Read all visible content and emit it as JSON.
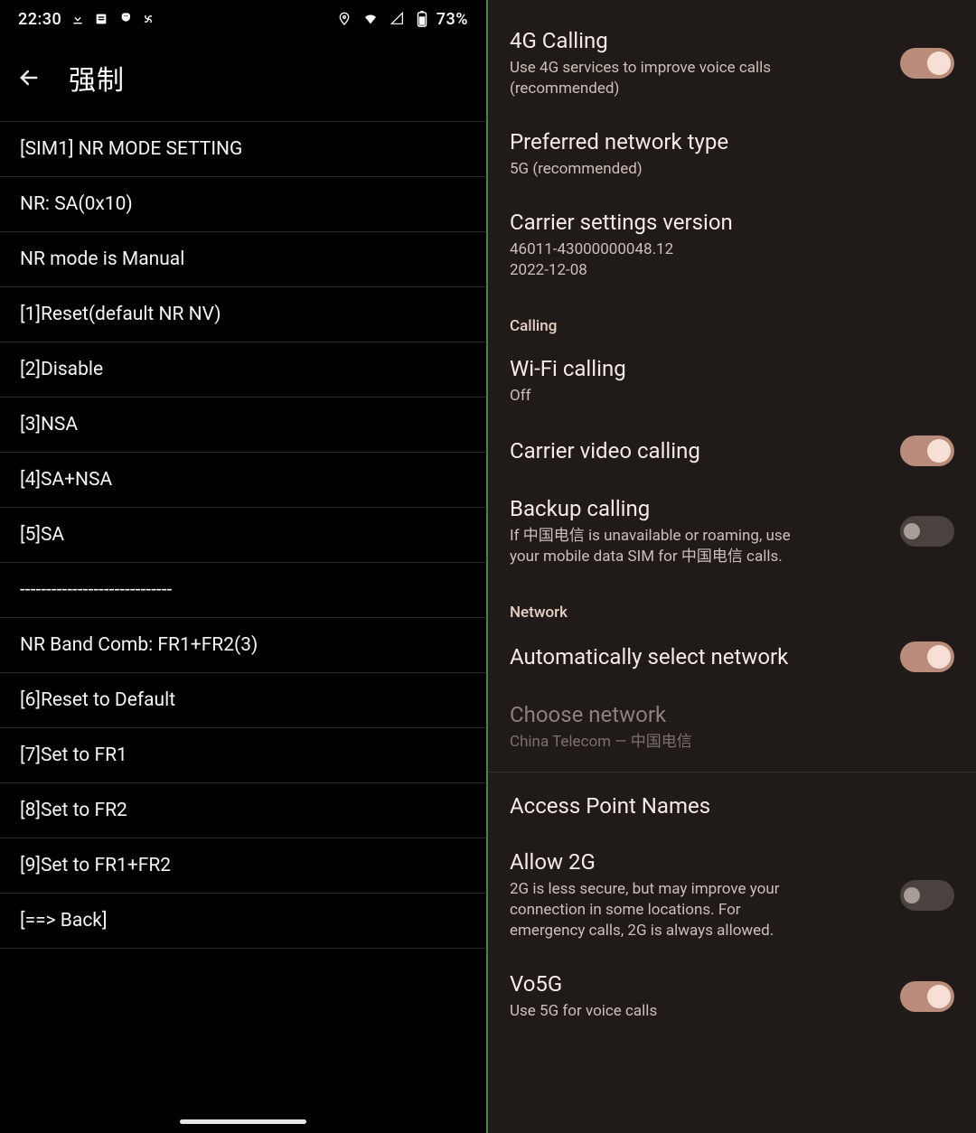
{
  "left": {
    "status": {
      "time": "22:30",
      "battery": "73%"
    },
    "app_title": "强制",
    "menu": [
      "[SIM1] NR MODE SETTING",
      "NR: SA(0x10)",
      "NR mode is Manual",
      "[1]Reset(default NR NV)",
      "[2]Disable",
      "[3]NSA",
      "[4]SA+NSA",
      "[5]SA",
      "-----------------------------",
      "NR Band Comb: FR1+FR2(3)",
      "[6]Reset to Default",
      "[7]Set to FR1",
      "[8]Set to FR2",
      "[9]Set to FR1+FR2",
      "[==> Back]"
    ]
  },
  "right": {
    "items": [
      {
        "kind": "toggle",
        "name": "4g-calling",
        "title": "4G Calling",
        "sub": "Use 4G services to improve voice calls (recommended)",
        "on": true
      },
      {
        "kind": "link",
        "name": "preferred-network",
        "title": "Preferred network type",
        "sub": "5G (recommended)"
      },
      {
        "kind": "link",
        "name": "carrier-version",
        "title": "Carrier settings version",
        "sub": "46011-43000000048.12\n2022-12-08"
      },
      {
        "kind": "header",
        "title": "Calling"
      },
      {
        "kind": "link",
        "name": "wifi-calling",
        "title": "Wi-Fi calling",
        "sub": "Off"
      },
      {
        "kind": "toggle",
        "name": "carrier-video-calling",
        "title": "Carrier video calling",
        "sub": "",
        "on": true
      },
      {
        "kind": "toggle",
        "name": "backup-calling",
        "title": "Backup calling",
        "sub": "If 中国电信 is unavailable or roaming, use your mobile data SIM for 中国电信 calls.",
        "on": false
      },
      {
        "kind": "header",
        "title": "Network"
      },
      {
        "kind": "toggle",
        "name": "auto-select-network",
        "title": "Automatically select network",
        "sub": "",
        "on": true
      },
      {
        "kind": "link",
        "name": "choose-network",
        "title": "Choose network",
        "sub": "China Telecom — 中国电信",
        "disabled": true
      },
      {
        "kind": "divider"
      },
      {
        "kind": "link",
        "name": "apn",
        "title": "Access Point Names",
        "sub": ""
      },
      {
        "kind": "toggle",
        "name": "allow-2g",
        "title": "Allow 2G",
        "sub": "2G is less secure, but may improve your connection in some locations. For emergency calls, 2G is always allowed.",
        "on": false
      },
      {
        "kind": "toggle",
        "name": "vo5g",
        "title": "Vo5G",
        "sub": "Use 5G for voice calls",
        "on": true
      }
    ]
  }
}
